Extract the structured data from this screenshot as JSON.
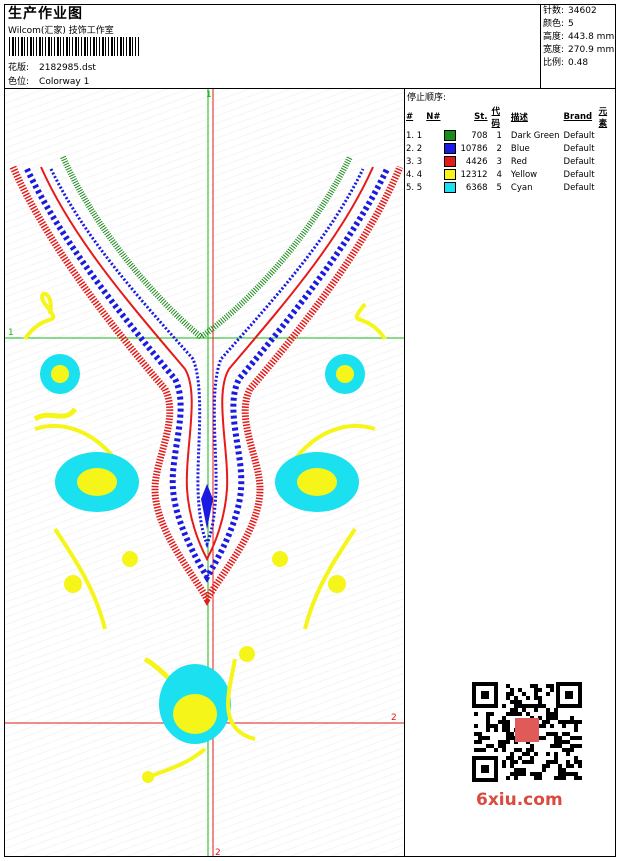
{
  "header": {
    "title": "生产作业图",
    "subtitle": "Wilcom(汇家) 技饰工作室",
    "design_label": "花版:",
    "design_value": "2182985.dst",
    "colorway_label": "色位:",
    "colorway_value": "Colorway 1"
  },
  "stats": [
    {
      "label": "针数:",
      "value": "34602"
    },
    {
      "label": "颜色:",
      "value": "5"
    },
    {
      "label": "高度:",
      "value": "443.8 mm"
    },
    {
      "label": "宽度:",
      "value": "270.9 mm"
    },
    {
      "label": "比例:",
      "value": "0.48"
    }
  ],
  "stop_sequence": {
    "title": "停止顺序:",
    "columns": [
      "#",
      "N#",
      "St.",
      "代码",
      "描述",
      "Brand",
      "元素"
    ],
    "rows": [
      {
        "idx": "1. 1",
        "color": "#1a8a1a",
        "st": "708",
        "code": "1",
        "desc": "Dark Green",
        "brand": "Default"
      },
      {
        "idx": "2. 2",
        "color": "#1a1ae0",
        "st": "10786",
        "code": "2",
        "desc": "Blue",
        "brand": "Default"
      },
      {
        "idx": "3. 3",
        "color": "#e61a1a",
        "st": "4426",
        "code": "3",
        "desc": "Red",
        "brand": "Default"
      },
      {
        "idx": "4. 4",
        "color": "#f5f51a",
        "st": "12312",
        "code": "4",
        "desc": "Yellow",
        "brand": "Default"
      },
      {
        "idx": "5. 5",
        "color": "#1ae0f0",
        "st": "6368",
        "code": "5",
        "desc": "Cyan",
        "brand": "Default"
      }
    ]
  },
  "canvas": {
    "marker_1": "1",
    "marker_2": "2"
  },
  "watermark": "6xiu.com"
}
